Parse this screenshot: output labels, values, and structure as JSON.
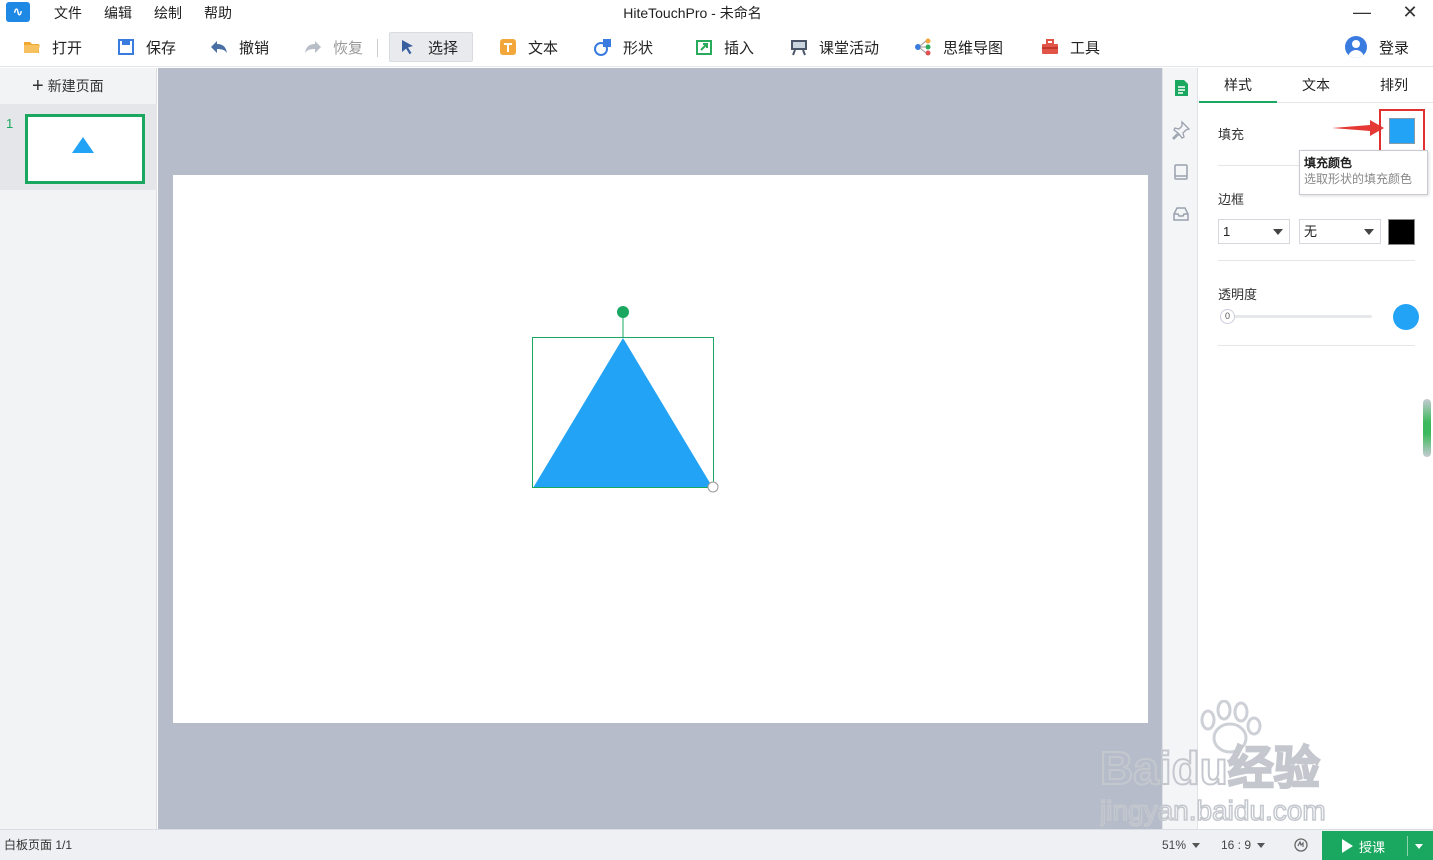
{
  "titlebar": {
    "menu": [
      "文件",
      "编辑",
      "绘制",
      "帮助"
    ],
    "title": "HiteTouchPro - 未命名",
    "minimize": "—",
    "close": "✕"
  },
  "toolbar": {
    "open": "打开",
    "save": "保存",
    "undo": "撤销",
    "redo": "恢复",
    "select": "选择",
    "text": "文本",
    "shape": "形状",
    "insert": "插入",
    "classroom": "课堂活动",
    "mindmap": "思维导图",
    "tools": "工具",
    "login": "登录"
  },
  "pages": {
    "new_page": "新建页面",
    "items": [
      {
        "number": "1"
      }
    ]
  },
  "canvas": {
    "shape": "triangle",
    "fill": "#22a3f5",
    "selection_color": "#1aa760"
  },
  "properties": {
    "tabs": [
      "样式",
      "文本",
      "排列"
    ],
    "active_tab": "样式",
    "fill_label": "填充",
    "fill_color": "#22a3f5",
    "tooltip_title": "填充颜色",
    "tooltip_desc": "选取形状的填充颜色",
    "border_label": "边框",
    "border_width": "1",
    "border_style": "无",
    "border_color": "#000000",
    "opacity_label": "透明度",
    "opacity_value": "0"
  },
  "status": {
    "page_info": "白板页面 1/1",
    "zoom": "51%",
    "ratio": "16 : 9",
    "teach": "授课"
  },
  "watermark": {
    "brand": "Baidu经验",
    "url": "jingyan.baidu.com"
  }
}
